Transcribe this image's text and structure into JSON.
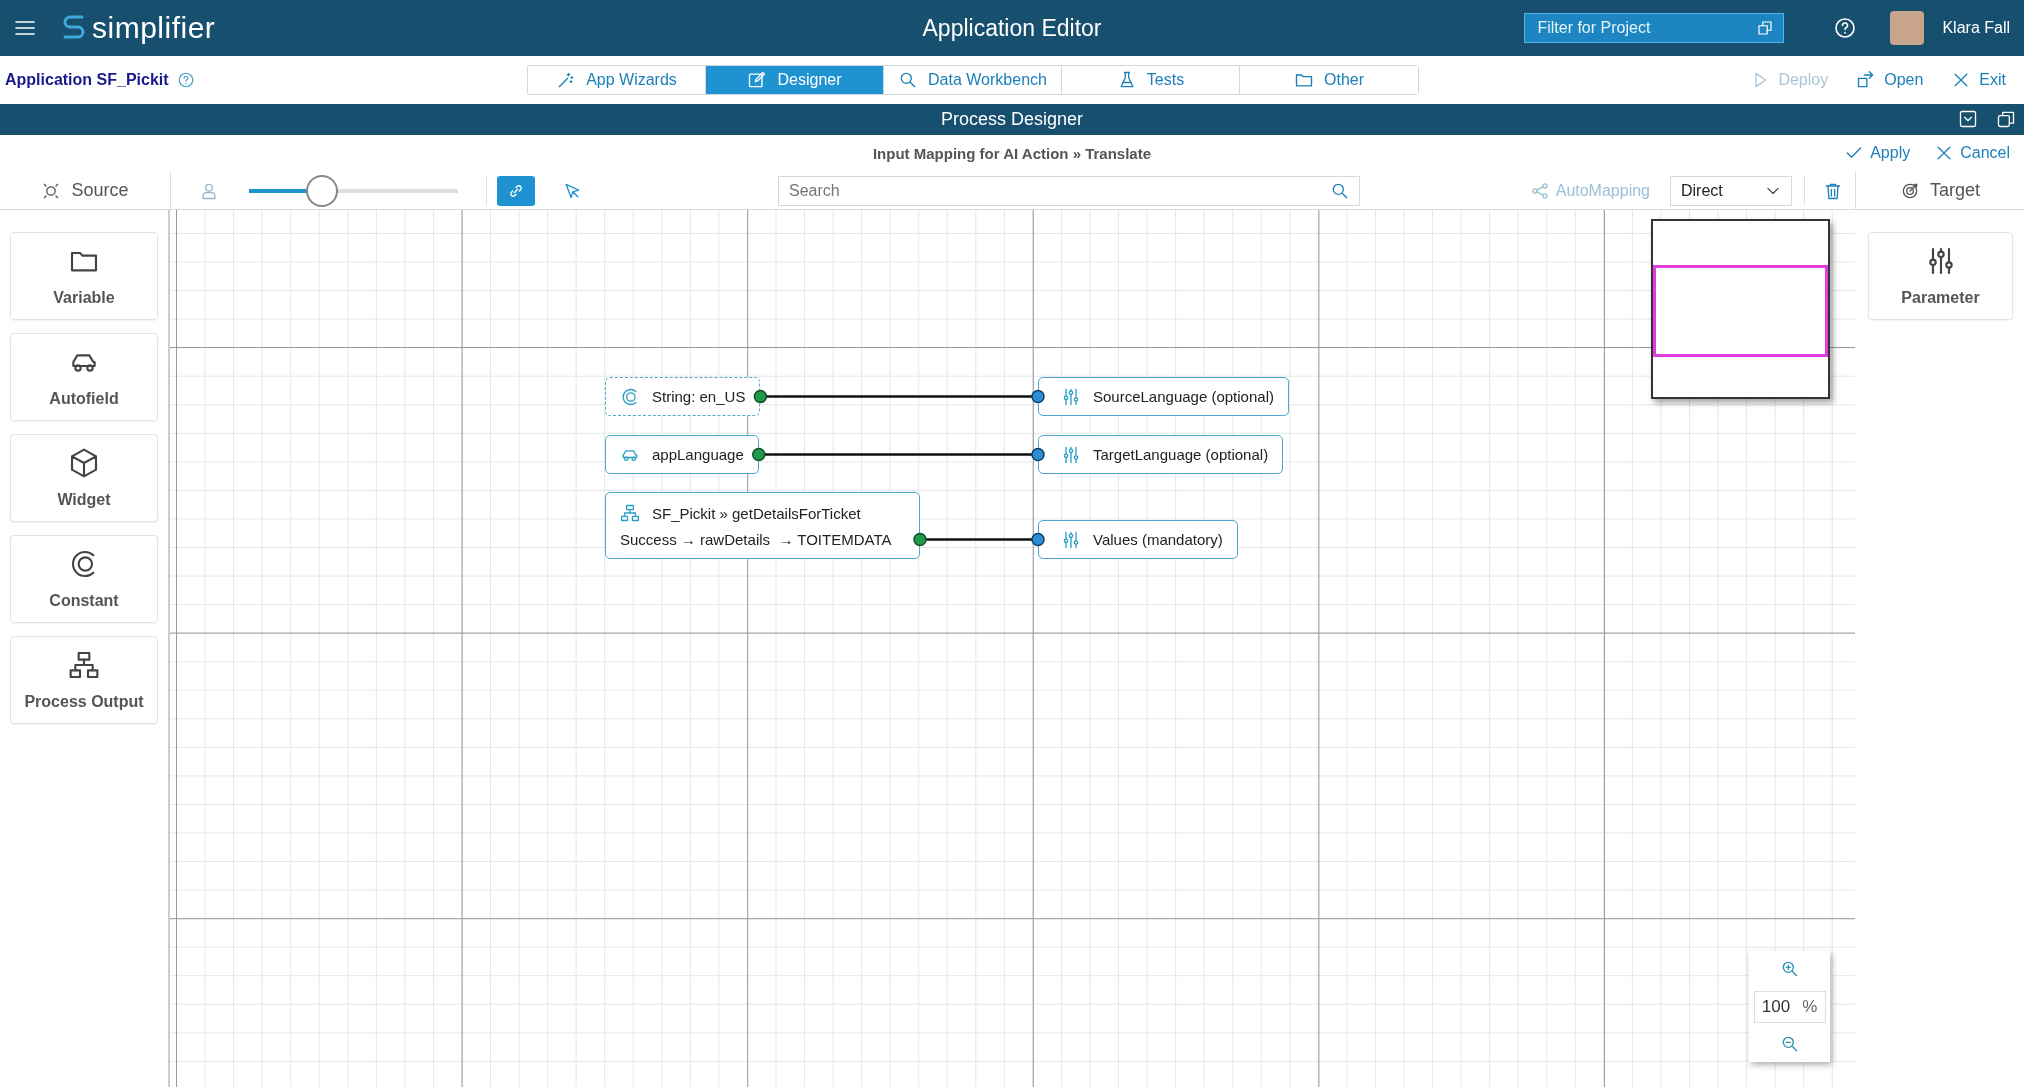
{
  "header": {
    "logo": "simplifier",
    "title": "Application Editor",
    "filter": {
      "placeholder": "Filter for Project"
    },
    "user": "Klara Fall"
  },
  "subheader": {
    "app_label": "Application SF_Pickit",
    "tabs": [
      {
        "label": "App Wizards",
        "selected": false
      },
      {
        "label": "Designer",
        "selected": true
      },
      {
        "label": "Data Workbench",
        "selected": false
      },
      {
        "label": "Tests",
        "selected": false
      },
      {
        "label": "Other",
        "selected": false
      }
    ],
    "actions": [
      {
        "label": "Deploy",
        "disabled": true
      },
      {
        "label": "Open",
        "disabled": false
      },
      {
        "label": "Exit",
        "disabled": false
      }
    ]
  },
  "panel": {
    "title": "Process Designer",
    "mapping_title": "Input Mapping for AI Action » Translate",
    "apply": "Apply",
    "cancel": "Cancel"
  },
  "toolbar": {
    "source": "Source",
    "slider": {
      "level": 0.35
    },
    "link_mode": {
      "on": true
    },
    "search": {
      "placeholder": "Search"
    },
    "automapping": {
      "label": "AutoMapping",
      "disabled": true
    },
    "mode": "Direct",
    "target": "Target"
  },
  "sidebar": {
    "items": [
      {
        "label": "Variable"
      },
      {
        "label": "Autofield"
      },
      {
        "label": "Widget"
      },
      {
        "label": "Constant"
      },
      {
        "label": "Process Output"
      }
    ]
  },
  "canvas": {
    "sources": [
      {
        "kind": "constant",
        "label": "String: en_US"
      },
      {
        "kind": "autofield",
        "label": "appLanguage"
      },
      {
        "kind": "process_output",
        "label": "SF_Pickit » getDetailsForTicket",
        "detail": "Success → rawDetails  → TOITEMDATA"
      }
    ],
    "targets": [
      {
        "kind": "parameter",
        "label": "SourceLanguage (optional)"
      },
      {
        "kind": "parameter",
        "label": "TargetLanguage (optional)"
      },
      {
        "kind": "parameter",
        "label": "Values (mandatory)"
      }
    ],
    "zoom": {
      "value": "100",
      "unit": "%"
    }
  },
  "right_panel": {
    "items": [
      {
        "label": "Parameter"
      }
    ]
  }
}
